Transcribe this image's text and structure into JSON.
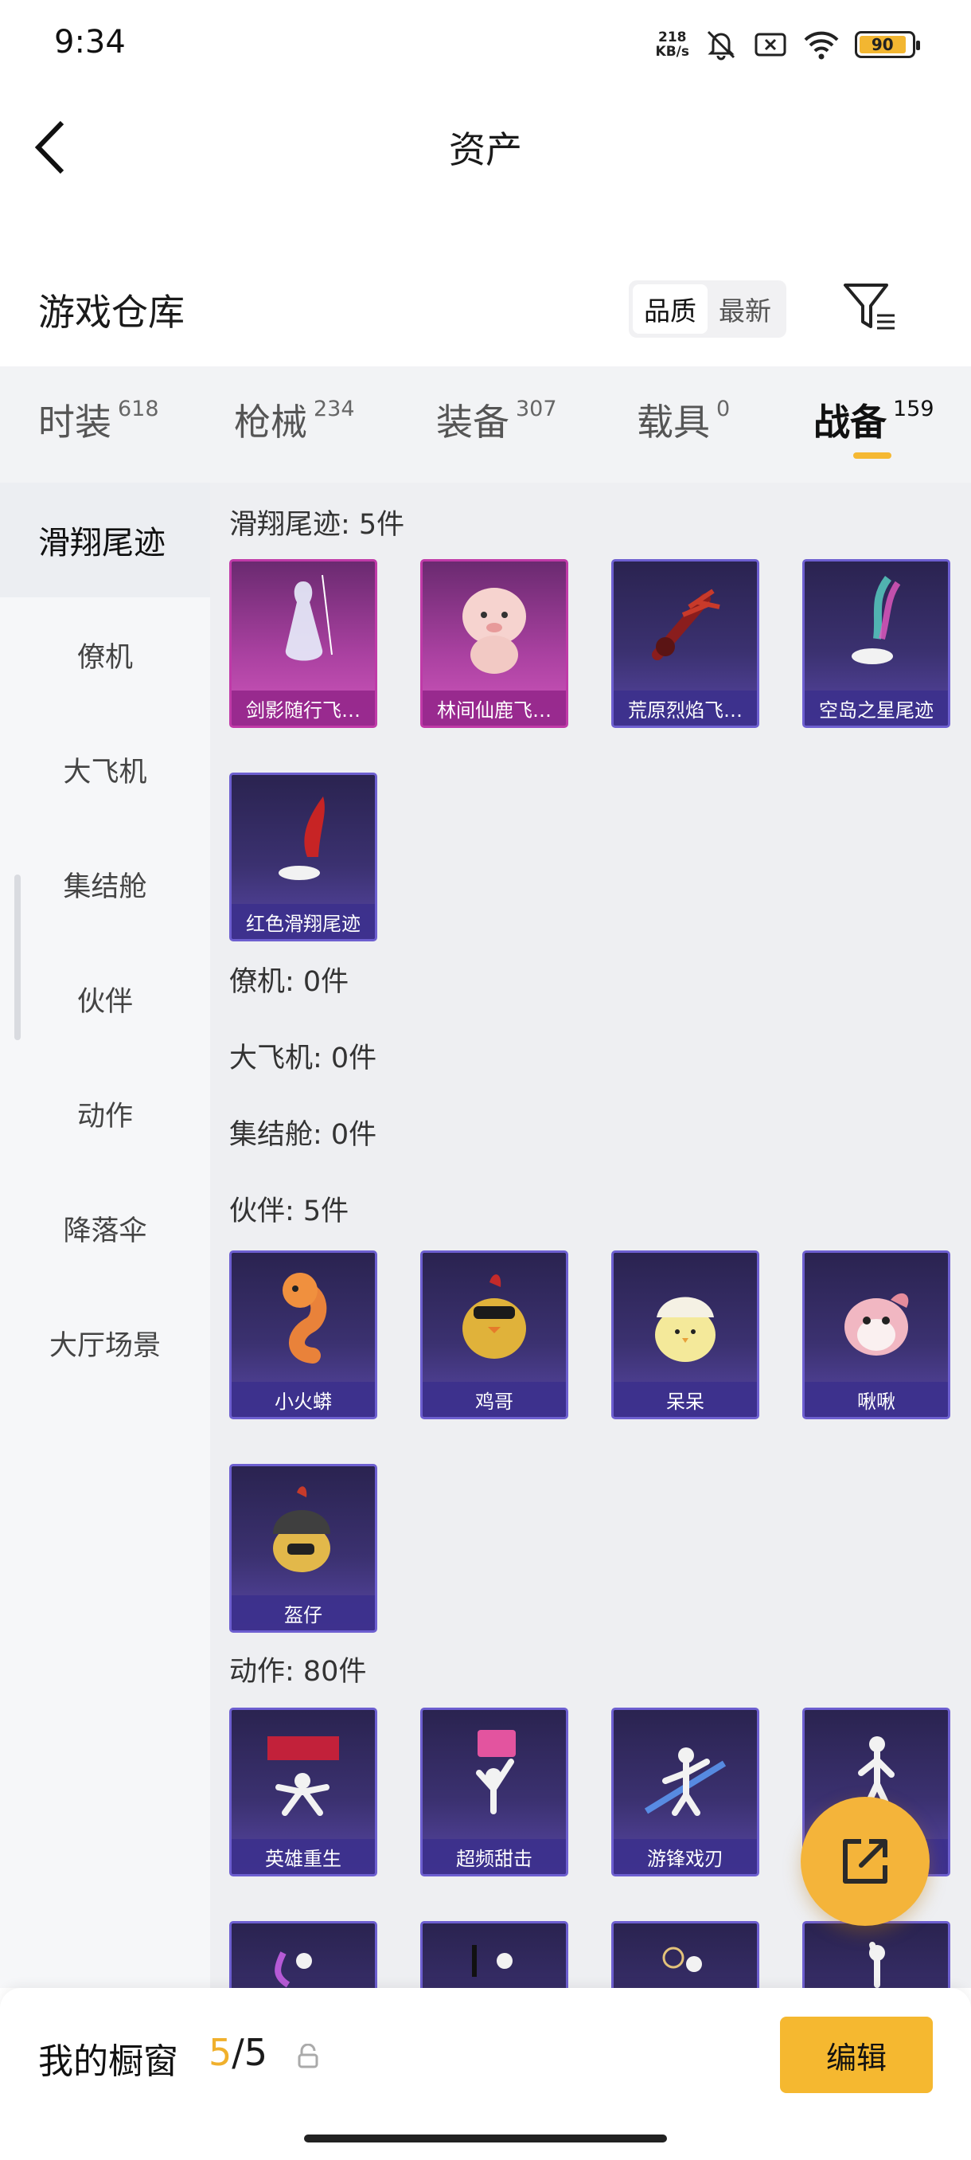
{
  "status": {
    "time": "9:34",
    "net_speed_value": "218",
    "net_speed_unit": "KB/s",
    "battery": "90"
  },
  "header": {
    "title": "资产"
  },
  "section": {
    "title": "游戏仓库",
    "sort_options": [
      "品质",
      "最新"
    ],
    "active_sort": "品质"
  },
  "tabs": [
    {
      "label": "时装",
      "count": "618"
    },
    {
      "label": "枪械",
      "count": "234"
    },
    {
      "label": "装备",
      "count": "307"
    },
    {
      "label": "载具",
      "count": "0"
    },
    {
      "label": "战备",
      "count": "159",
      "active": true
    }
  ],
  "sidebar": {
    "items": [
      "滑翔尾迹",
      "僚机",
      "大飞机",
      "集结舱",
      "伙伴",
      "动作",
      "降落伞",
      "大厅场景"
    ],
    "active": "滑翔尾迹"
  },
  "groups": {
    "glide": {
      "title": "滑翔尾迹: 5件",
      "items": [
        "剑影随行飞…",
        "林间仙鹿飞…",
        "荒原烈焰飞…",
        "空岛之星尾迹",
        "红色滑翔尾迹"
      ]
    },
    "wingman": {
      "title": "僚机: 0件"
    },
    "plane": {
      "title": "大飞机: 0件"
    },
    "pod": {
      "title": "集结舱: 0件"
    },
    "partner": {
      "title": "伙伴: 5件",
      "items": [
        "小火蟒",
        "鸡哥",
        "呆呆",
        "啾啾",
        "盔仔"
      ]
    },
    "emote": {
      "title": "动作: 80件",
      "items": [
        "英雄重生",
        "超频甜击",
        "游锋戏刃",
        ""
      ]
    }
  },
  "bottom": {
    "showcase_label": "我的橱窗",
    "showcase_current": "5",
    "showcase_sep": "/5",
    "edit_label": "编辑"
  },
  "colors": {
    "accent": "#f5b830",
    "card_blue": "#5847a6",
    "card_pink": "#d257be"
  }
}
